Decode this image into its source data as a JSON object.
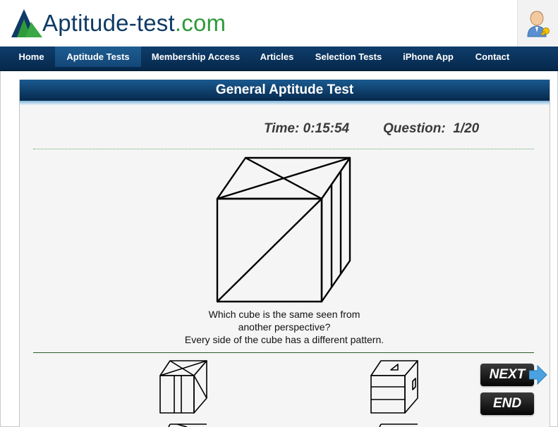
{
  "header": {
    "logo_text_primary": "Aptitude-test",
    "logo_text_secondary": ".com"
  },
  "nav": {
    "items": [
      {
        "label": "Home"
      },
      {
        "label": "Aptitude Tests"
      },
      {
        "label": "Membership Access"
      },
      {
        "label": "Articles"
      },
      {
        "label": "Selection Tests"
      },
      {
        "label": "iPhone App"
      },
      {
        "label": "Contact"
      }
    ],
    "active_index": 1
  },
  "test": {
    "title": "General Aptitude Test",
    "time_label": "Time:",
    "time_value": "0:15:54",
    "question_label": "Question:",
    "question_value": "1/20",
    "question_lines": [
      "Which cube is the same seen from",
      "another perspective?",
      "Every side of the cube has a different pattern."
    ]
  },
  "buttons": {
    "next_label": "NEXT",
    "end_label": "END"
  },
  "icons": {
    "logo": "triangle-logo-icon",
    "user": "user-key-icon",
    "next_arrow": "arrow-right-icon"
  },
  "colors": {
    "nav_dark": "#06294c",
    "brand_blue": "#0f3a66",
    "brand_green": "#2e9a3a",
    "arrow_blue": "#4aa3e0"
  }
}
